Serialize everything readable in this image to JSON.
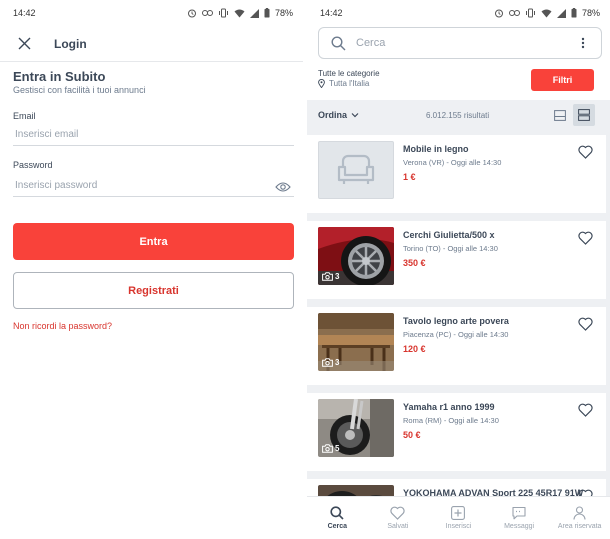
{
  "status_left": {
    "time": "14:42",
    "battery": "78%"
  },
  "status_right": {
    "time": "14:42",
    "battery": "78%"
  },
  "login": {
    "title": "Login",
    "heading": "Entra in Subito",
    "subheading": "Gestisci con facilità i tuoi annunci",
    "email_label": "Email",
    "email_placeholder": "Inserisci email",
    "password_label": "Password",
    "password_placeholder": "Inserisci password",
    "login_button": "Entra",
    "register_button": "Registrati",
    "forgot_link": "Non ricordi la password?"
  },
  "search": {
    "placeholder": "Cerca",
    "category_label": "Tutte le categorie",
    "location": "Tutta l'Italia",
    "filter_button": "Filtri",
    "sort_label": "Ordina",
    "results": "6.012.155 risultati"
  },
  "listings": [
    {
      "title": "Mobile in legno",
      "meta": "Verona (VR) - Oggi alle 14:30",
      "price": "1 €",
      "photos": ""
    },
    {
      "title": "Cerchi Giulietta/500 x",
      "meta": "Torino (TO) - Oggi alle 14:30",
      "price": "350 €",
      "photos": "3"
    },
    {
      "title": "Tavolo legno arte povera",
      "meta": "Piacenza (PC) - Oggi alle 14:30",
      "price": "120 €",
      "photos": "3"
    },
    {
      "title": "Yamaha r1 anno 1999",
      "meta": "Roma (RM) - Oggi alle 14:30",
      "price": "50 €",
      "photos": "5"
    },
    {
      "title": "YOKOHAMA ADVAN Sport 225 45R17 91W",
      "meta": "",
      "price": "",
      "photos": ""
    }
  ],
  "bottom_nav": [
    {
      "label": "Cerca",
      "icon": "search-icon",
      "active": true
    },
    {
      "label": "Salvati",
      "icon": "heart-icon",
      "active": false
    },
    {
      "label": "Inserisci",
      "icon": "add-icon",
      "active": false
    },
    {
      "label": "Messaggi",
      "icon": "chat-icon",
      "active": false
    },
    {
      "label": "Area riservata",
      "icon": "user-icon",
      "active": false
    }
  ],
  "colors": {
    "accent": "#f9423a",
    "price": "#d8352e",
    "text": "#3c4858",
    "muted": "#6d7b8d",
    "background": "#eef0f3"
  }
}
